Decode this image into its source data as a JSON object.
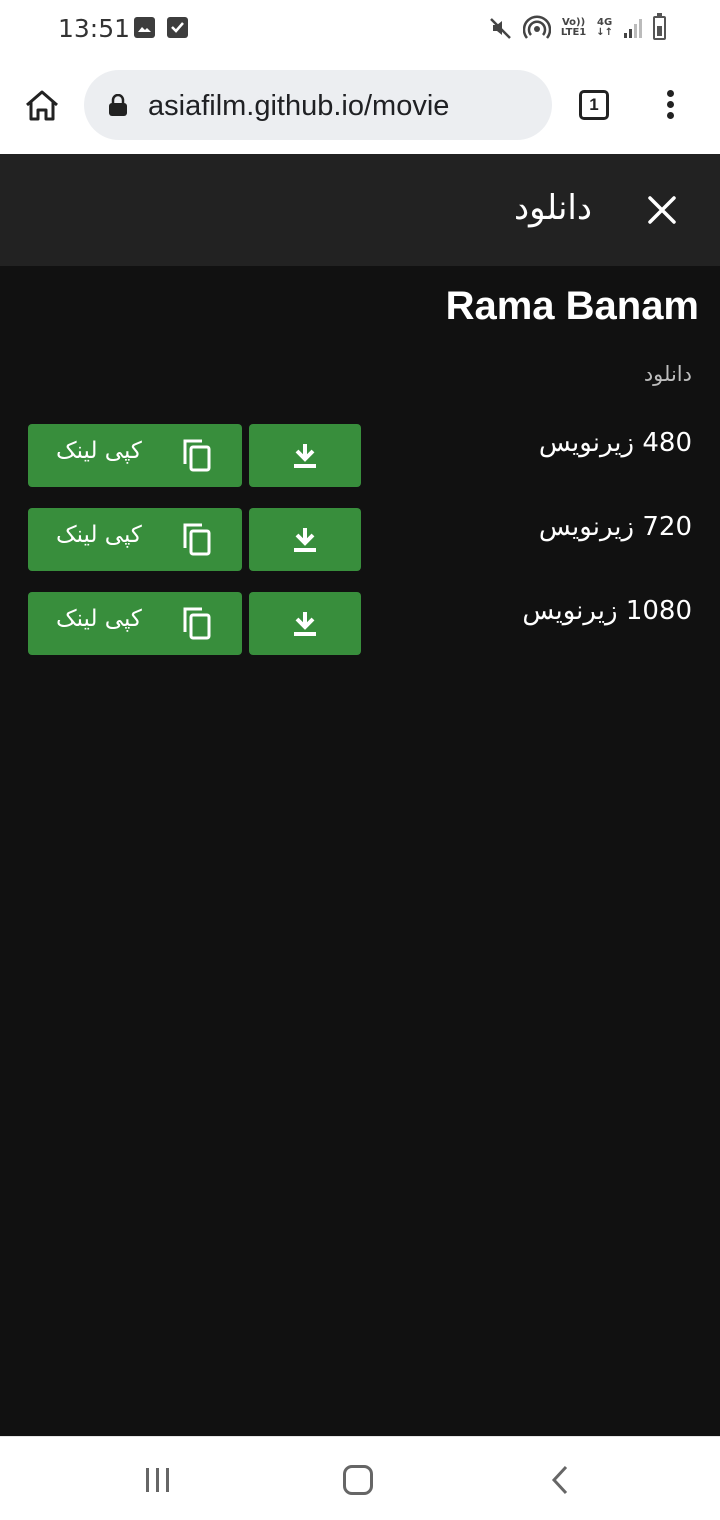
{
  "status_bar": {
    "time": "13:51",
    "left_icons": [
      "image-icon",
      "check-box-icon"
    ],
    "right_icons": [
      "mute-icon",
      "hotspot-icon",
      "volte-icon",
      "4g-icon",
      "signal-icon",
      "battery-icon"
    ],
    "volte_label_top": "Vo))",
    "volte_label_bottom": "LTE1",
    "network_label": "4G"
  },
  "browser": {
    "url": "asiafilm.github.io/movie",
    "tab_count": "1"
  },
  "header": {
    "title": "دانلود"
  },
  "main": {
    "movie_title": "Rama Banam",
    "section_label": "دانلود",
    "downloads": [
      {
        "quality": "480 زیرنویس",
        "copy_label": "کپی لینک"
      },
      {
        "quality": "720 زیرنویس",
        "copy_label": "کپی لینک"
      },
      {
        "quality": "1080 زیرنویس",
        "copy_label": "کپی لینک"
      }
    ]
  },
  "colors": {
    "button_green": "#388e3c",
    "header_bg": "#222222",
    "content_bg": "#111111"
  }
}
